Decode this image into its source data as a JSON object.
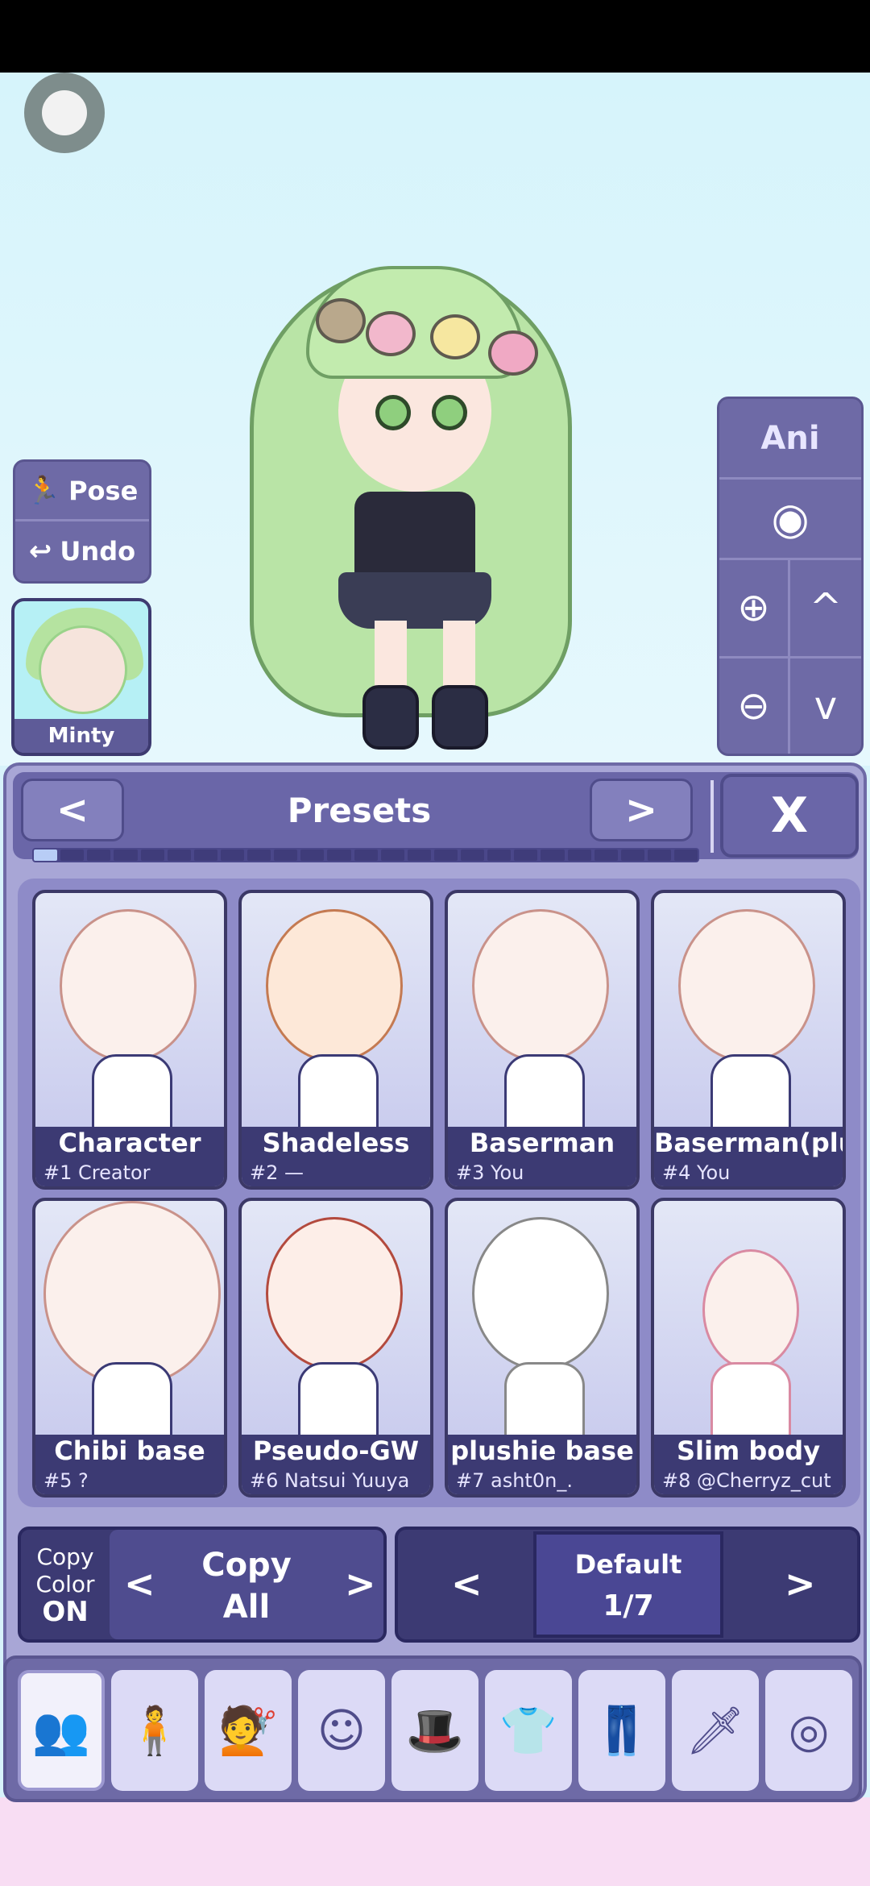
{
  "left_tools": {
    "pose_label": "Pose",
    "undo_label": "Undo"
  },
  "character": {
    "name": "Minty"
  },
  "right_tools": {
    "ani_label": "Ani"
  },
  "panel": {
    "title": "Presets",
    "prev_label": "<",
    "next_label": ">",
    "close_label": "X"
  },
  "presets": [
    {
      "name": "Character",
      "sub": "#1 Creator"
    },
    {
      "name": "Shadeless",
      "sub": "#2 —"
    },
    {
      "name": "Baserman",
      "sub": "#3 You"
    },
    {
      "name": "Baserman(plu",
      "sub": "#4 You"
    },
    {
      "name": "Chibi base",
      "sub": "#5 ?"
    },
    {
      "name": "Pseudo-GW",
      "sub": "#6 Natsui Yuuya"
    },
    {
      "name": "plushie base",
      "sub": "#7 asht0n_."
    },
    {
      "name": "Slim body",
      "sub": "#8 @Cherryz_cut"
    }
  ],
  "copy": {
    "color_line1": "Copy",
    "color_line2": "Color",
    "color_state": "ON",
    "mode_line1": "Copy",
    "mode_line2": "All",
    "prev": "<",
    "next": ">"
  },
  "slot": {
    "name": "Default",
    "page": "1/7",
    "prev": "<",
    "next": ">"
  },
  "categories": [
    {
      "icon": "characters-icon"
    },
    {
      "icon": "body-icon"
    },
    {
      "icon": "hair-icon"
    },
    {
      "icon": "face-icon"
    },
    {
      "icon": "accessories-icon"
    },
    {
      "icon": "top-icon"
    },
    {
      "icon": "bottom-icon"
    },
    {
      "icon": "weapon-icon"
    },
    {
      "icon": "profile-icon"
    }
  ],
  "colors": {
    "panel": "#6a66a8",
    "panel_dark": "#3c3a73",
    "stage": "#d8f3fb",
    "bottom": "#f8ddf3"
  }
}
